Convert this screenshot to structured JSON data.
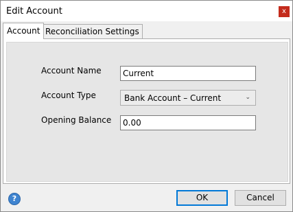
{
  "window": {
    "title": "Edit Account",
    "close_label": "x"
  },
  "tabs": [
    {
      "label": "Account",
      "active": true
    },
    {
      "label": "Reconciliation Settings",
      "active": false
    }
  ],
  "form": {
    "account_name": {
      "label": "Account Name",
      "value": "Current"
    },
    "account_type": {
      "label": "Account Type",
      "value": "Bank Account – Current"
    },
    "opening_balance": {
      "label": "Opening Balance",
      "value": "0.00"
    }
  },
  "footer": {
    "help_label": "?",
    "ok_label": "OK",
    "cancel_label": "Cancel"
  }
}
